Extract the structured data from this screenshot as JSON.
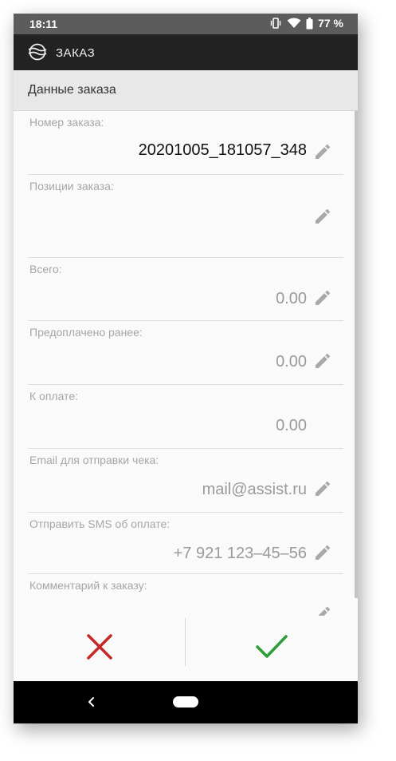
{
  "status_bar": {
    "time": "18:11",
    "battery_percent": "77 %",
    "icons": [
      "vibrate-icon",
      "wifi-icon",
      "battery-icon"
    ]
  },
  "app_bar": {
    "title": "ЗАКАЗ",
    "logo_icon": "assist-logo-icon"
  },
  "section": {
    "title": "Данные заказа"
  },
  "fields": [
    {
      "label": "Номер заказа:",
      "value": "20201005_181057_348",
      "editable": true
    },
    {
      "label": "Позиции заказа:",
      "value": "",
      "editable": true
    },
    {
      "label": "Всего:",
      "value": "0.00",
      "editable": true
    },
    {
      "label": "Предоплачено ранее:",
      "value": "0.00",
      "editable": true
    },
    {
      "label": "К оплате:",
      "value": "0.00",
      "editable": false
    },
    {
      "label": "Email для отправки чека:",
      "value": "mail@assist.ru",
      "editable": true
    },
    {
      "label": "Отправить SMS об оплате:",
      "value": "+7 921 123–45–56",
      "editable": true
    },
    {
      "label": "Комментарий к заказу:",
      "value": "",
      "editable": true
    }
  ],
  "actions": {
    "cancel_icon": "close-icon",
    "confirm_icon": "check-icon",
    "cancel_color": "#c62828",
    "confirm_color": "#2e9e3a"
  },
  "colors": {
    "status_bar": "#5c5c5c",
    "app_bar": "#222222",
    "section_header": "#e8e8e8"
  }
}
